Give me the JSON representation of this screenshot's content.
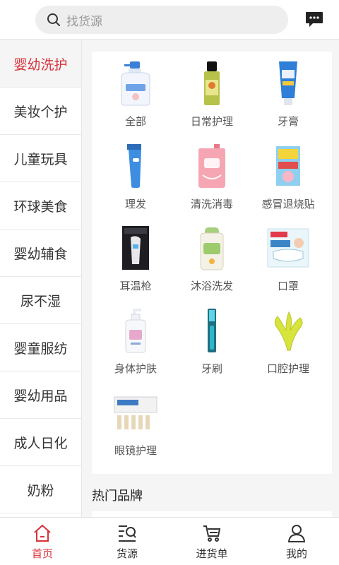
{
  "search": {
    "placeholder": "找货源"
  },
  "sidebar": {
    "items": [
      {
        "label": "婴幼洗护",
        "active": true
      },
      {
        "label": "美妆个护"
      },
      {
        "label": "儿童玩具"
      },
      {
        "label": "环球美食"
      },
      {
        "label": "婴幼辅食"
      },
      {
        "label": "尿不湿"
      },
      {
        "label": "婴童服纺"
      },
      {
        "label": "婴幼用品"
      },
      {
        "label": "成人日化"
      },
      {
        "label": "奶粉"
      }
    ]
  },
  "categories": [
    {
      "label": "全部",
      "icon": "lotion-bottle-icon"
    },
    {
      "label": "日常护理",
      "icon": "oil-bottle-icon"
    },
    {
      "label": "牙膏",
      "icon": "toothpaste-icon"
    },
    {
      "label": "理发",
      "icon": "hair-clipper-icon"
    },
    {
      "label": "清洗消毒",
      "icon": "refill-pouch-icon"
    },
    {
      "label": "感冒退烧贴",
      "icon": "fever-patch-box-icon"
    },
    {
      "label": "耳温枪",
      "icon": "ear-thermometer-icon"
    },
    {
      "label": "沐浴洗发",
      "icon": "shampoo-bottle-icon"
    },
    {
      "label": "口罩",
      "icon": "mask-box-icon"
    },
    {
      "label": "身体护肤",
      "icon": "pump-bottle-icon"
    },
    {
      "label": "牙刷",
      "icon": "toothbrush-icon"
    },
    {
      "label": "口腔护理",
      "icon": "teether-icon"
    },
    {
      "label": "眼镜护理",
      "icon": "ampoule-box-icon"
    }
  ],
  "hot_brands": {
    "title": "热门品牌"
  },
  "tabbar": {
    "items": [
      {
        "label": "首页",
        "icon": "home-icon",
        "active": true
      },
      {
        "label": "货源",
        "icon": "search-list-icon"
      },
      {
        "label": "进货单",
        "icon": "cart-icon"
      },
      {
        "label": "我的",
        "icon": "user-icon"
      }
    ]
  },
  "colors": {
    "accent": "#d8303a",
    "background": "#f5f5f5"
  }
}
